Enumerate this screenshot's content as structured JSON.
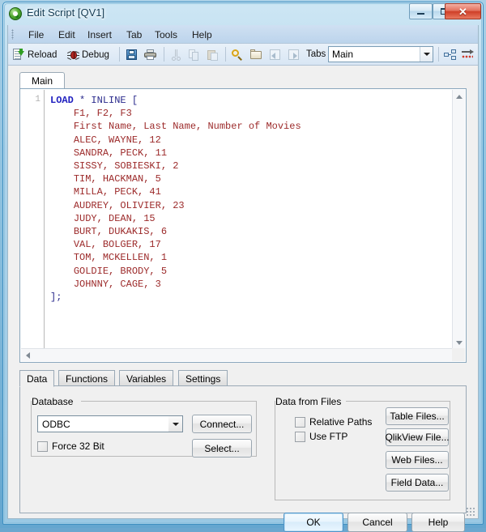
{
  "window": {
    "title": "Edit Script [QV1]",
    "app_icon": "qlikview-logo-icon",
    "minimize_label": "–",
    "maximize_label": "□",
    "close_label": "✕"
  },
  "menubar": {
    "items": [
      {
        "label": "File"
      },
      {
        "label": "Edit"
      },
      {
        "label": "Insert"
      },
      {
        "label": "Tab"
      },
      {
        "label": "Tools"
      },
      {
        "label": "Help"
      }
    ]
  },
  "toolbar": {
    "reload_label": "Reload",
    "debug_label": "Debug",
    "save_tooltip": "Save",
    "print_tooltip": "Print",
    "cut_tooltip": "Cut",
    "copy_tooltip": "Copy",
    "paste_tooltip": "Paste",
    "search_tooltip": "Search",
    "folder_tooltip": "Open",
    "prev_tooltip": "Previous",
    "next_tooltip": "Next",
    "tabs_label": "Tabs",
    "tabs_value": "Main",
    "hierarchy_tooltip": "Table Viewer",
    "autocorrect_tooltip": "Syntax Check"
  },
  "editor": {
    "tab_label": "Main",
    "line_number": "1",
    "code_lines": [
      {
        "indent": 0,
        "tokens": [
          {
            "text": "LOAD",
            "cls": "kw"
          },
          {
            "text": " * ",
            "cls": "op"
          },
          {
            "text": "INLINE",
            "cls": "op"
          },
          {
            "text": " [",
            "cls": "brk"
          }
        ]
      },
      {
        "indent": 1,
        "tokens": [
          {
            "text": "F1, F2, F3",
            "cls": "dat"
          }
        ]
      },
      {
        "indent": 1,
        "tokens": [
          {
            "text": "First Name, Last Name, Number of Movies",
            "cls": "dat"
          }
        ]
      },
      {
        "indent": 1,
        "tokens": [
          {
            "text": "ALEC, WAYNE, 12",
            "cls": "dat"
          }
        ]
      },
      {
        "indent": 1,
        "tokens": [
          {
            "text": "SANDRA, PECK, 11",
            "cls": "dat"
          }
        ]
      },
      {
        "indent": 1,
        "tokens": [
          {
            "text": "SISSY, SOBIESKI, 2",
            "cls": "dat"
          }
        ]
      },
      {
        "indent": 1,
        "tokens": [
          {
            "text": "TIM, HACKMAN, 5",
            "cls": "dat"
          }
        ]
      },
      {
        "indent": 1,
        "tokens": [
          {
            "text": "MILLA, PECK, 41",
            "cls": "dat"
          }
        ]
      },
      {
        "indent": 1,
        "tokens": [
          {
            "text": "AUDREY, OLIVIER, 23",
            "cls": "dat"
          }
        ]
      },
      {
        "indent": 1,
        "tokens": [
          {
            "text": "JUDY, DEAN, 15",
            "cls": "dat"
          }
        ]
      },
      {
        "indent": 1,
        "tokens": [
          {
            "text": "BURT, DUKAKIS, 6",
            "cls": "dat"
          }
        ]
      },
      {
        "indent": 1,
        "tokens": [
          {
            "text": "VAL, BOLGER, 17",
            "cls": "dat"
          }
        ]
      },
      {
        "indent": 1,
        "tokens": [
          {
            "text": "TOM, MCKELLEN, 1",
            "cls": "dat"
          }
        ]
      },
      {
        "indent": 1,
        "tokens": [
          {
            "text": "GOLDIE, BRODY, 5",
            "cls": "dat"
          }
        ]
      },
      {
        "indent": 1,
        "tokens": [
          {
            "text": "JOHNNY, CAGE, 3",
            "cls": "dat"
          }
        ]
      },
      {
        "indent": 0,
        "tokens": [
          {
            "text": "];",
            "cls": "brk"
          }
        ]
      }
    ]
  },
  "panel": {
    "tabs": [
      {
        "label": "Data",
        "active": true
      },
      {
        "label": "Functions",
        "active": false
      },
      {
        "label": "Variables",
        "active": false
      },
      {
        "label": "Settings",
        "active": false
      }
    ],
    "database": {
      "group_label": "Database",
      "combo_value": "ODBC",
      "force32_label": "Force 32 Bit",
      "force32_checked": false,
      "connect_label": "Connect...",
      "select_label": "Select..."
    },
    "data_from_files": {
      "group_label": "Data from Files",
      "relative_paths_label": "Relative Paths",
      "relative_paths_checked": false,
      "use_ftp_label": "Use FTP",
      "use_ftp_checked": false,
      "buttons": [
        {
          "label": "Table Files..."
        },
        {
          "label": "QlikView File..."
        },
        {
          "label": "Web Files..."
        },
        {
          "label": "Field Data..."
        }
      ]
    }
  },
  "dialog_buttons": {
    "ok_label": "OK",
    "cancel_label": "Cancel",
    "help_label": "Help"
  },
  "colors": {
    "keyword": "#1f1fbf",
    "data_text": "#9c2a2a",
    "accent": "#4f94c8",
    "close_button": "#cf3f28"
  }
}
